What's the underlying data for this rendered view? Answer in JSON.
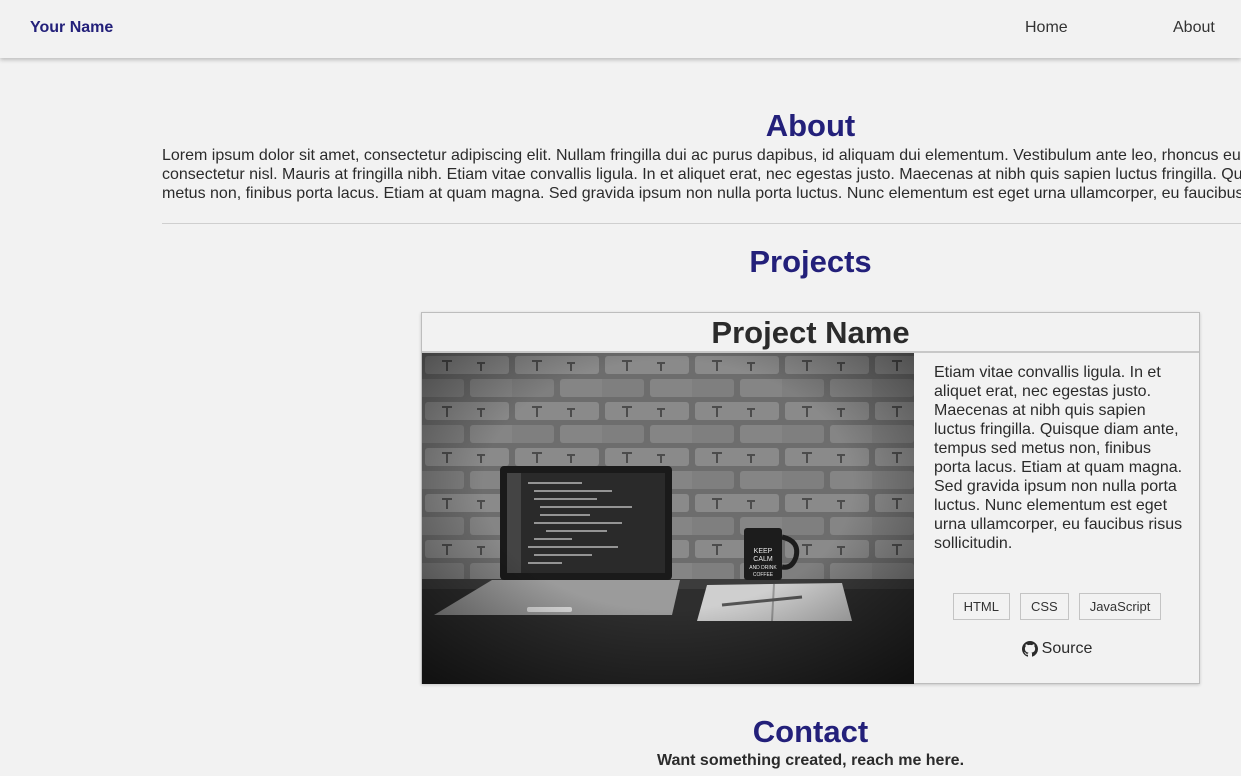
{
  "nav": {
    "brand": "Your Name",
    "links": [
      "Home",
      "About"
    ]
  },
  "about": {
    "title": "About",
    "lines": [
      "Lorem ipsum dolor sit amet, consectetur adipiscing elit. Nullam fringilla dui ac purus dapibus, id aliquam dui elementum. Vestibulum ante leo, rhoncus eu",
      "consectetur nisl. Mauris at fringilla nibh. Etiam vitae convallis ligula. In et aliquet erat, nec egestas justo. Maecenas at nibh quis sapien luctus fringilla. Qu",
      "metus non, finibus porta lacus. Etiam at quam magna. Sed gravida ipsum non nulla porta luctus. Nunc elementum est eget urna ullamcorper, eu faucibus"
    ]
  },
  "projects": {
    "title": "Projects",
    "card": {
      "name": "Project Name",
      "description": "Etiam vitae convallis ligula. In et aliquet erat, nec egestas justo. Maecenas at nibh quis sapien luctus fringilla. Quisque diam ante, tempus sed metus non, finibus porta lacus. Etiam at quam magna. Sed gravida ipsum non nulla porta luctus. Nunc elementum est eget urna ullamcorper, eu faucibus risus sollicitudin.",
      "tags": [
        "HTML",
        "CSS",
        "JavaScript"
      ],
      "source_label": "Source",
      "mug_text": "KEEP CALM AND DRINK COFFEE",
      "source_icon": "github-icon"
    }
  },
  "contact": {
    "title": "Contact",
    "subtitle": "Want something created, reach me here."
  },
  "colors": {
    "accent": "#23207a",
    "background": "#f2f2f2",
    "text": "#2b2b2b"
  }
}
